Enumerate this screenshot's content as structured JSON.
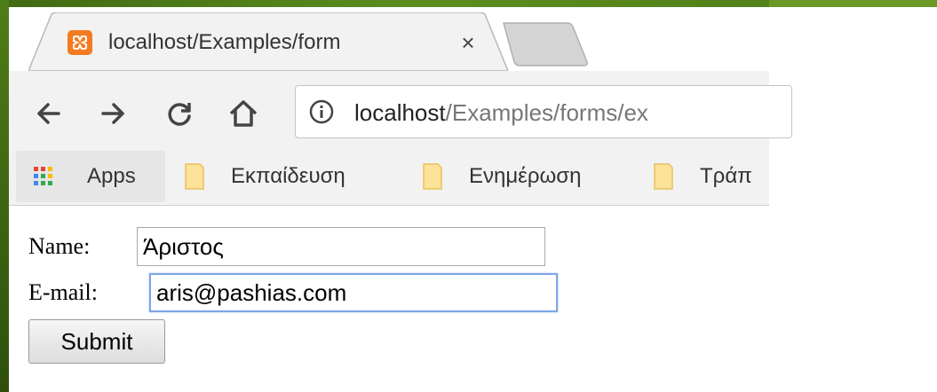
{
  "browser": {
    "tab": {
      "title": "localhost/Examples/form",
      "close_glyph": "×"
    },
    "address_bar": {
      "host": "localhost",
      "path": "/Examples/forms/ex"
    },
    "bookmarks": {
      "apps_label": "Apps",
      "items": [
        {
          "label": "Εκπαίδευση"
        },
        {
          "label": "Ενημέρωση"
        },
        {
          "label": "Τράπ"
        }
      ]
    }
  },
  "form": {
    "name_label": "Name:",
    "name_value": "Άριστος",
    "email_label": "E-mail:",
    "email_value": "aris@pashias.com",
    "submit_label": "Submit"
  },
  "colors": {
    "slide_green": "#4e7b18",
    "xampp_orange": "#f47b20",
    "focus_blue": "#7fa6e6"
  },
  "icons": [
    "back-icon",
    "forward-icon",
    "reload-icon",
    "home-icon",
    "info-icon",
    "apps-grid-icon",
    "folder-icon",
    "xampp-icon",
    "close-icon"
  ]
}
